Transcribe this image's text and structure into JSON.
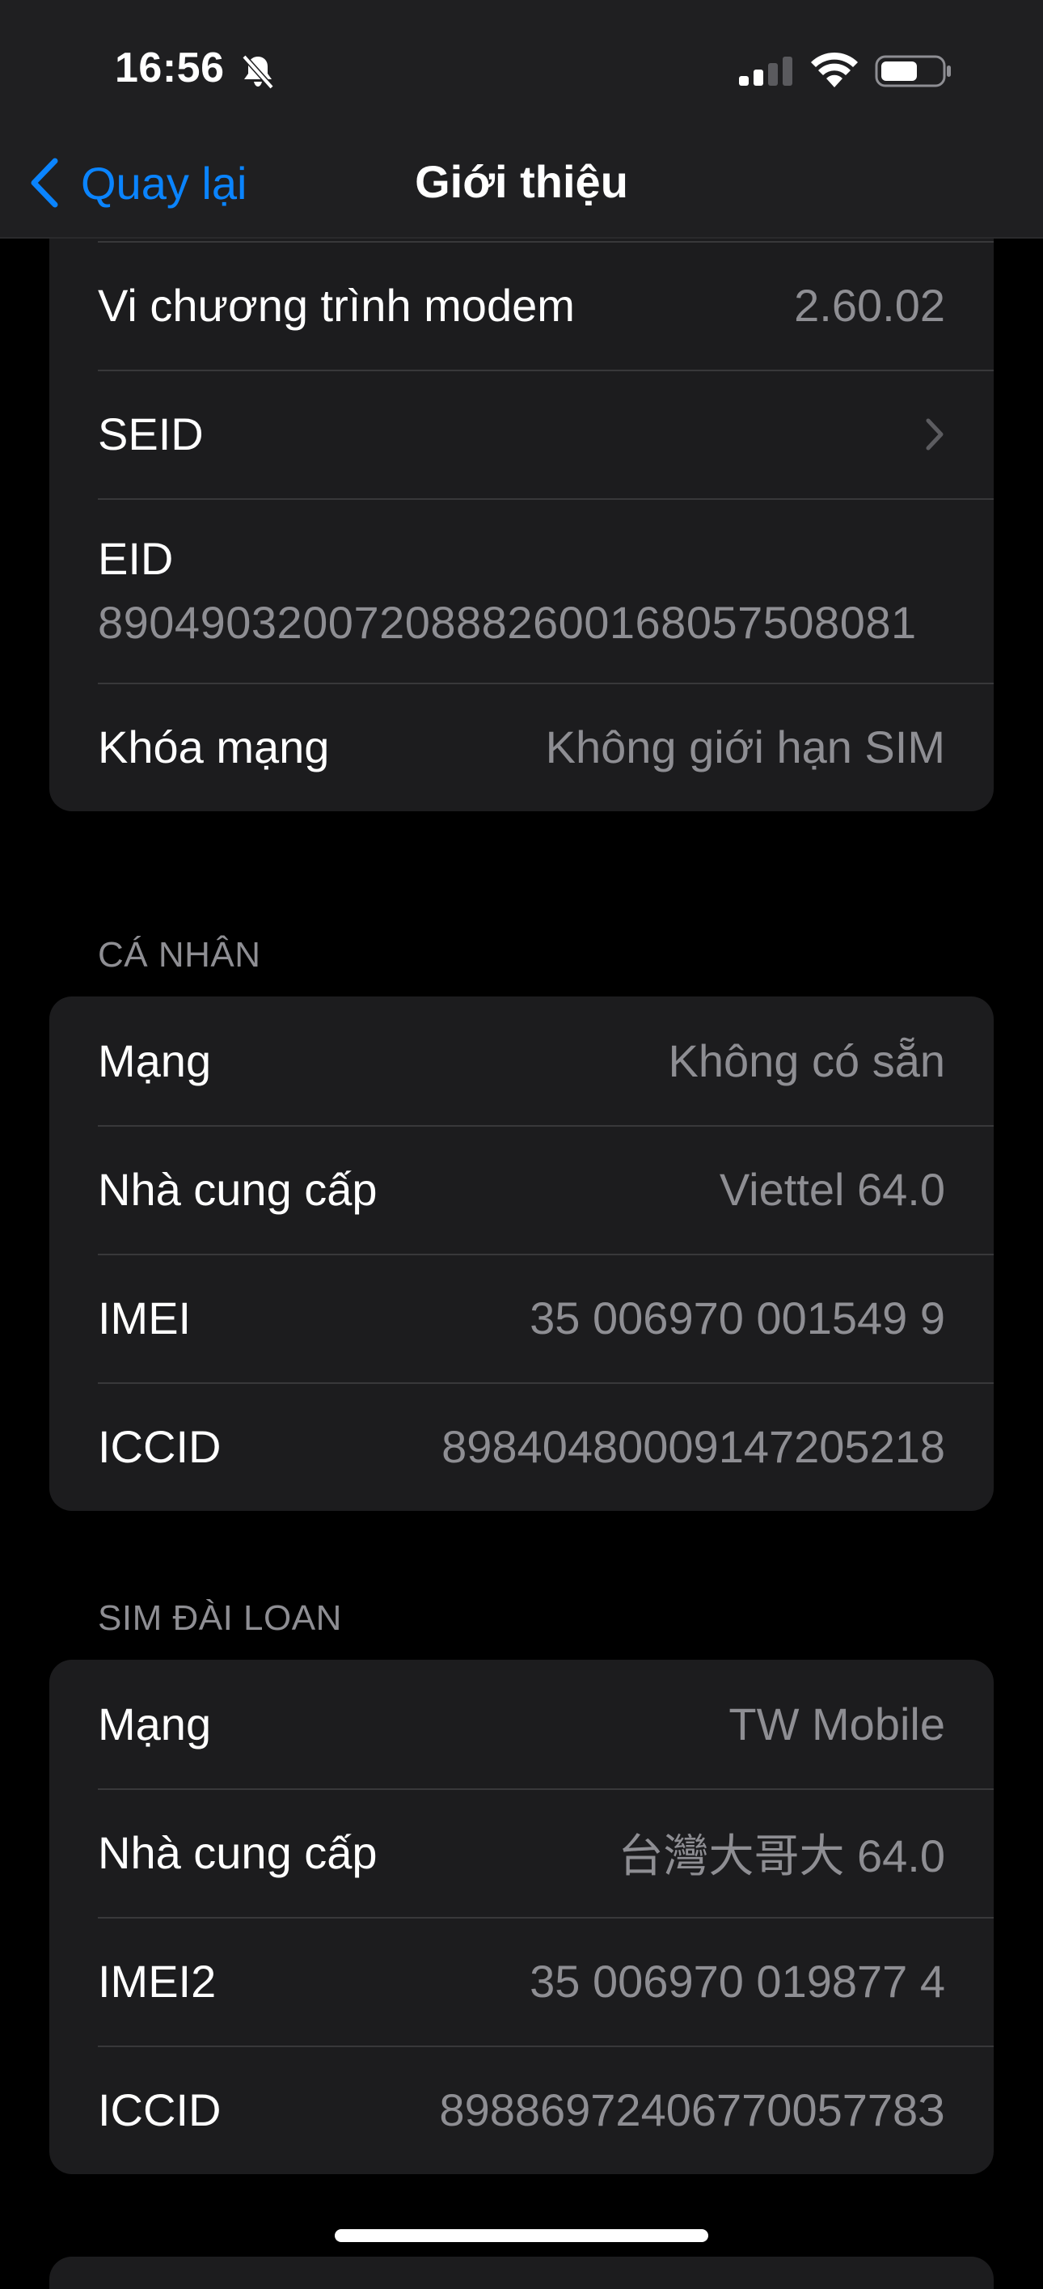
{
  "status_bar": {
    "time": "16:56",
    "icons": [
      "bell-slash-icon",
      "cellular-signal-icon",
      "wifi-icon",
      "battery-icon"
    ]
  },
  "nav": {
    "back_label": "Quay lại",
    "title": "Giới thiệu",
    "accent_color": "#0a84ff"
  },
  "device_group": {
    "rows": [
      {
        "label": "Vi chương trình modem",
        "value": "2.60.02"
      },
      {
        "label": "SEID",
        "value": ""
      },
      {
        "label": "EID",
        "value": "89049032007208882600168057508081"
      },
      {
        "label": "Khóa mạng",
        "value": "Không giới hạn SIM"
      }
    ]
  },
  "personal_section": {
    "header": "CÁ NHÂN",
    "rows": [
      {
        "label": "Mạng",
        "value": "Không có sẵn"
      },
      {
        "label": "Nhà cung cấp",
        "value": "Viettel 64.0"
      },
      {
        "label": "IMEI",
        "value": "35 006970 001549 9"
      },
      {
        "label": "ICCID",
        "value": "89840480009147205218"
      }
    ]
  },
  "taiwan_section": {
    "header": "SIM ĐÀI LOAN",
    "rows": [
      {
        "label": "Mạng",
        "value": "TW Mobile"
      },
      {
        "label": "Nhà cung cấp",
        "value": "台灣大哥大 64.0"
      },
      {
        "label": "IMEI2",
        "value": "35 006970 019877 4"
      },
      {
        "label": "ICCID",
        "value": "8988697240677005778З"
      }
    ]
  }
}
